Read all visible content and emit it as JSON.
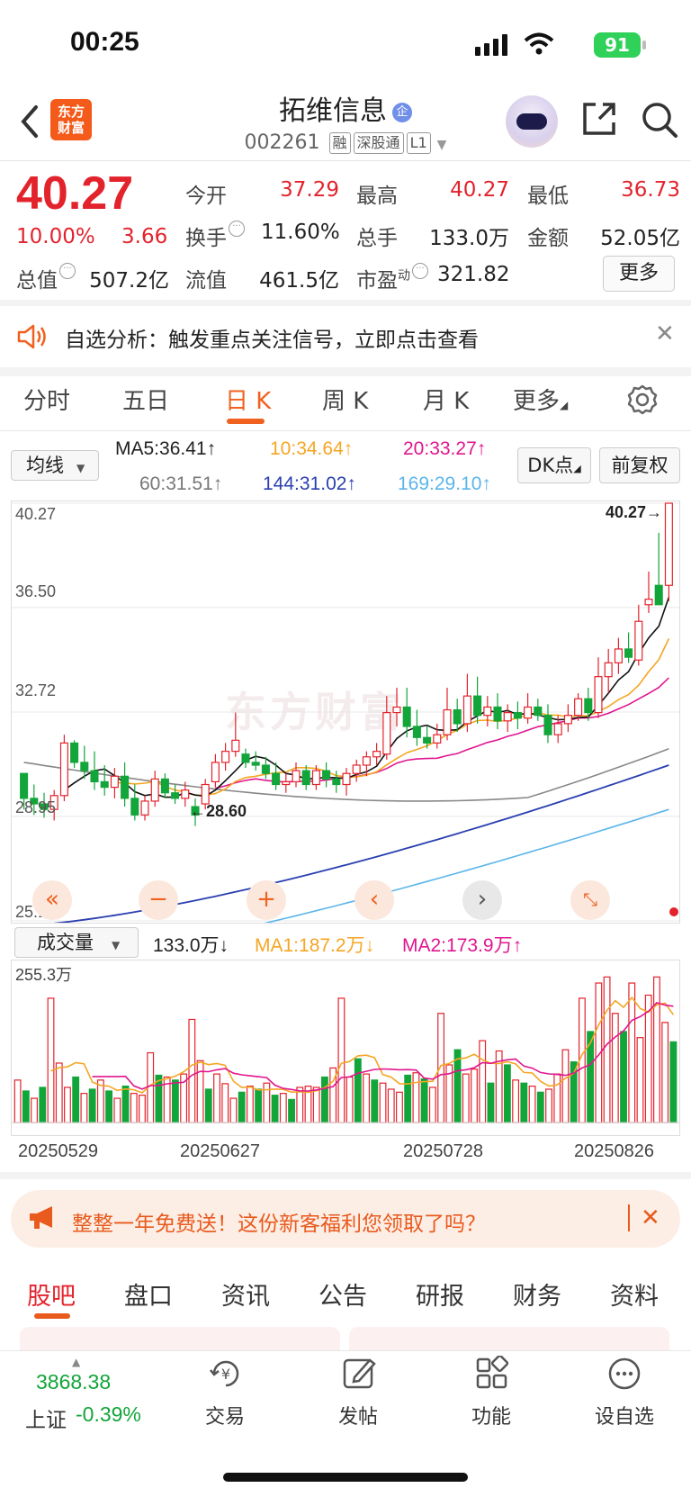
{
  "status": {
    "time": "00:25",
    "battery": "91"
  },
  "header": {
    "logo_line1": "东方",
    "logo_line2": "财富",
    "stock_name": "拓维信息",
    "stock_badge": "企",
    "stock_code": "002261",
    "tags": [
      "融",
      "深股通",
      "L1"
    ]
  },
  "quote": {
    "price": "40.27",
    "change_pct": "10.00%",
    "change_abs": "3.66",
    "open_label": "今开",
    "open": "37.29",
    "high_label": "最高",
    "high": "40.27",
    "low_label": "最低",
    "low": "36.73",
    "turnover_label": "换手",
    "turnover": "11.60%",
    "volume_label": "总手",
    "volume": "133.0万",
    "amount_label": "金额",
    "amount": "52.05亿",
    "mcap_label": "总值",
    "mcap": "507.2亿",
    "float_label": "流值",
    "float": "461.5亿",
    "pe_label": "市盈",
    "pe_sup": "动",
    "pe": "321.82",
    "more": "更多"
  },
  "alert": {
    "text": "自选分析：触发重点关注信号，立即点击查看"
  },
  "chart_tabs": [
    "分时",
    "五日",
    "日 K",
    "周 K",
    "月 K",
    "更多"
  ],
  "ma_legend": {
    "select": "均线",
    "ma5": "MA5:36.41↑",
    "ma10": "10:34.64↑",
    "ma20": "20:33.27↑",
    "ma60": "60:31.51↑",
    "ma144": "144:31.02↑",
    "ma169": "169:29.10↑",
    "dk": "DK点",
    "fq": "前复权"
  },
  "kchart": {
    "y_labels": [
      "40.27",
      "36.50",
      "32.72",
      "28.95",
      "25.17"
    ],
    "max_marker": "40.27→",
    "min_marker": "←28.60",
    "watermark": "东方财富"
  },
  "volume": {
    "select": "成交量",
    "current": "133.0万↓",
    "ma1": "MA1:187.2万↓",
    "ma2": "MA2:173.9万↑",
    "y_max": "255.3万",
    "dates": [
      "20250529",
      "20250627",
      "20250728",
      "20250826"
    ]
  },
  "chart_data": [
    {
      "type": "candlestick",
      "title": "日K",
      "ylim": [
        25.17,
        40.27
      ],
      "y_ticks": [
        40.27,
        36.5,
        32.72,
        28.95,
        25.17
      ],
      "x_ticks": [
        "20250529",
        "20250627",
        "20250728",
        "20250826"
      ],
      "ohlc": [
        [
          30.5,
          30.0,
          29.2,
          29.6
        ],
        [
          29.6,
          30.1,
          29.0,
          29.4
        ],
        [
          29.4,
          29.8,
          28.9,
          29.2
        ],
        [
          29.2,
          29.9,
          28.8,
          29.7
        ],
        [
          29.7,
          31.9,
          29.5,
          31.6
        ],
        [
          31.6,
          31.7,
          30.7,
          30.9
        ],
        [
          30.9,
          31.5,
          30.3,
          30.6
        ],
        [
          30.6,
          31.3,
          29.9,
          30.2
        ],
        [
          30.2,
          30.8,
          29.7,
          30.0
        ],
        [
          30.0,
          30.7,
          29.6,
          30.4
        ],
        [
          30.4,
          30.9,
          29.3,
          29.6
        ],
        [
          29.6,
          30.1,
          28.8,
          29.0
        ],
        [
          29.0,
          29.7,
          28.8,
          29.5
        ],
        [
          29.5,
          30.6,
          29.3,
          30.3
        ],
        [
          30.3,
          30.5,
          29.6,
          29.8
        ],
        [
          29.8,
          30.1,
          29.4,
          29.6
        ],
        [
          29.6,
          30.2,
          29.3,
          29.9
        ],
        [
          29.3,
          29.6,
          28.6,
          29.0
        ],
        [
          29.4,
          30.3,
          29.2,
          30.1
        ],
        [
          30.2,
          31.2,
          30.0,
          30.9
        ],
        [
          30.9,
          31.6,
          30.6,
          31.3
        ],
        [
          31.3,
          32.7,
          31.1,
          31.7
        ],
        [
          31.2,
          31.4,
          30.7,
          30.9
        ],
        [
          30.9,
          31.3,
          30.6,
          30.8
        ],
        [
          30.8,
          31.1,
          30.3,
          30.5
        ],
        [
          30.5,
          30.9,
          29.9,
          30.1
        ],
        [
          30.1,
          30.5,
          29.8,
          30.2
        ],
        [
          30.2,
          30.9,
          30.0,
          30.6
        ],
        [
          30.6,
          30.8,
          29.9,
          30.1
        ],
        [
          30.1,
          30.8,
          29.9,
          30.6
        ],
        [
          30.6,
          30.9,
          30.0,
          30.3
        ],
        [
          30.3,
          30.6,
          29.8,
          30.1
        ],
        [
          30.1,
          30.7,
          29.7,
          30.5
        ],
        [
          30.5,
          31.0,
          30.2,
          30.8
        ],
        [
          30.8,
          31.3,
          30.4,
          31.1
        ],
        [
          31.1,
          31.6,
          30.8,
          31.3
        ],
        [
          31.2,
          33.3,
          31.0,
          32.7
        ],
        [
          32.7,
          33.6,
          32.2,
          32.9
        ],
        [
          32.9,
          33.6,
          31.8,
          32.2
        ],
        [
          32.2,
          32.8,
          31.5,
          31.8
        ],
        [
          31.8,
          32.2,
          31.4,
          31.6
        ],
        [
          31.6,
          32.3,
          31.4,
          31.9
        ],
        [
          31.9,
          33.6,
          31.7,
          32.8
        ],
        [
          32.8,
          33.2,
          32.0,
          32.3
        ],
        [
          32.3,
          34.1,
          32.0,
          33.3
        ],
        [
          33.3,
          34.0,
          32.3,
          32.6
        ],
        [
          32.6,
          33.3,
          32.2,
          32.9
        ],
        [
          32.9,
          33.4,
          32.1,
          32.4
        ],
        [
          32.4,
          33.0,
          32.0,
          32.7
        ],
        [
          32.7,
          33.1,
          32.1,
          32.5
        ],
        [
          32.5,
          33.4,
          32.3,
          32.9
        ],
        [
          32.9,
          33.2,
          32.4,
          32.6
        ],
        [
          32.6,
          33.0,
          31.6,
          31.9
        ],
        [
          31.9,
          32.6,
          31.6,
          32.3
        ],
        [
          32.3,
          33.0,
          32.0,
          32.6
        ],
        [
          32.6,
          33.4,
          32.4,
          33.2
        ],
        [
          33.2,
          33.6,
          32.4,
          32.7
        ],
        [
          32.7,
          34.7,
          32.5,
          34.0
        ],
        [
          34.0,
          35.0,
          33.4,
          34.5
        ],
        [
          34.5,
          35.4,
          34.1,
          35.0
        ],
        [
          35.0,
          35.6,
          34.5,
          34.7
        ],
        [
          34.6,
          36.6,
          34.4,
          36.0
        ],
        [
          36.6,
          37.8,
          36.3,
          36.8
        ],
        [
          37.3,
          39.2,
          36.7,
          36.6
        ],
        [
          37.3,
          40.27,
          36.73,
          40.27
        ]
      ]
    },
    {
      "type": "bar",
      "title": "成交量",
      "ylim": [
        0,
        255.3
      ],
      "y_unit": "万",
      "series": [
        {
          "name": "MA1",
          "values": []
        },
        {
          "name": "MA2",
          "values": []
        }
      ],
      "values": [
        70,
        52,
        40,
        58,
        205,
        98,
        58,
        75,
        48,
        55,
        70,
        52,
        40,
        60,
        48,
        45,
        115,
        78,
        75,
        70,
        80,
        170,
        102,
        55,
        80,
        64,
        40,
        50,
        60,
        55,
        65,
        45,
        48,
        38,
        58,
        60,
        58,
        75,
        90,
        205,
        75,
        105,
        80,
        70,
        65,
        55,
        50,
        78,
        82,
        72,
        58,
        180,
        95,
        120,
        80,
        88,
        135,
        65,
        118,
        95,
        70,
        65,
        60,
        50,
        55,
        80,
        120,
        100,
        205,
        150,
        230,
        240,
        180,
        150,
        230,
        140,
        210,
        240,
        165,
        133
      ]
    }
  ],
  "promo": {
    "text": "整整一年免费送！这份新客福利您领取了吗？"
  },
  "bottom_tabs": [
    "股吧",
    "盘口",
    "资讯",
    "公告",
    "研报",
    "财务",
    "资料"
  ],
  "bottom_nav": {
    "index_value": "3868.38",
    "index_name": "上证",
    "index_change": "-0.39%",
    "items": [
      "交易",
      "发帖",
      "功能",
      "设自选"
    ]
  },
  "colors": {
    "up": "#e3232c",
    "down": "#12a53a",
    "accent": "#f0601e"
  }
}
